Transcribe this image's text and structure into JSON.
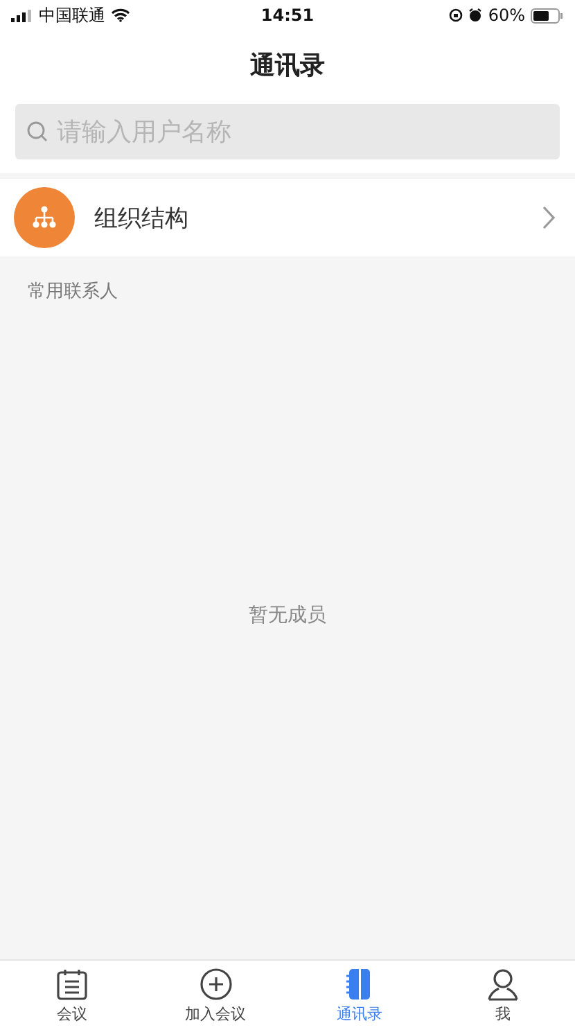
{
  "status_bar": {
    "carrier": "中国联通",
    "time": "14:51",
    "battery": "60%"
  },
  "title": "通讯录",
  "search": {
    "placeholder": "请输入用户名称"
  },
  "org_row": {
    "label": "组织结构"
  },
  "section": {
    "label": "常用联系人",
    "empty": "暂无成员"
  },
  "tabs": [
    {
      "label": "会议",
      "kind": "calendar",
      "selected": false
    },
    {
      "label": "加入会议",
      "kind": "plus",
      "selected": false
    },
    {
      "label": "通讯录",
      "kind": "book",
      "selected": true
    },
    {
      "label": "我",
      "kind": "person",
      "selected": false
    }
  ]
}
